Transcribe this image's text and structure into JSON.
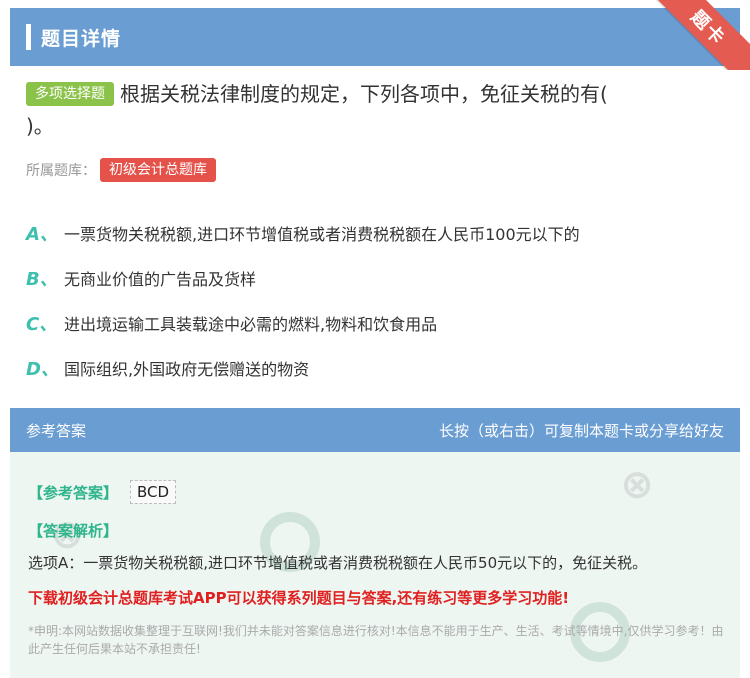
{
  "header": {
    "title": "题目详情",
    "ribbon": "题卡"
  },
  "question": {
    "type_badge": "多项选择题",
    "text": "根据关税法律制度的规定，下列各项中，免征关税的有(",
    "text_cont": ")。",
    "bank_label": "所属题库：",
    "bank_name": "初级会计总题库"
  },
  "options": [
    {
      "letter": "A、",
      "text": "一票货物关税税额,进口环节增值税或者消费税税额在人民币100元以下的"
    },
    {
      "letter": "B、",
      "text": "无商业价值的广告品及货样"
    },
    {
      "letter": "C、",
      "text": "进出境运输工具装载途中必需的燃料,物料和饮食用品"
    },
    {
      "letter": "D、",
      "text": "国际组织,外国政府无偿赠送的物资"
    }
  ],
  "answer": {
    "head_left": "参考答案",
    "head_right": "长按（或右击）可复制本题卡或分享给好友",
    "answer_label": "【参考答案】",
    "answer_value": "BCD",
    "explain_label": "【答案解析】",
    "explain_text": "选项A：一票货物关税税额,进口环节增值税或者消费税税额在人民币50元以下的，免征关税。",
    "promo": "下载初级会计总题库考试APP可以获得系列题目与答案,还有练习等更多学习功能!",
    "disclaimer": "*申明:本网站数据收集整理于互联网!我们并未能对答案信息进行核对!本信息不能用于生产、生活、考试等情境中,仅供学习参考！由此产生任何后果本站不承担责任!"
  },
  "colors": {
    "header_bg": "#6a9dd2",
    "ribbon": "#e45b52",
    "type_badge": "#8bc34a",
    "bank_badge": "#e4524a",
    "option_letter": "#3fbfae",
    "answer_label": "#2fb58c",
    "promo": "#e02020"
  }
}
